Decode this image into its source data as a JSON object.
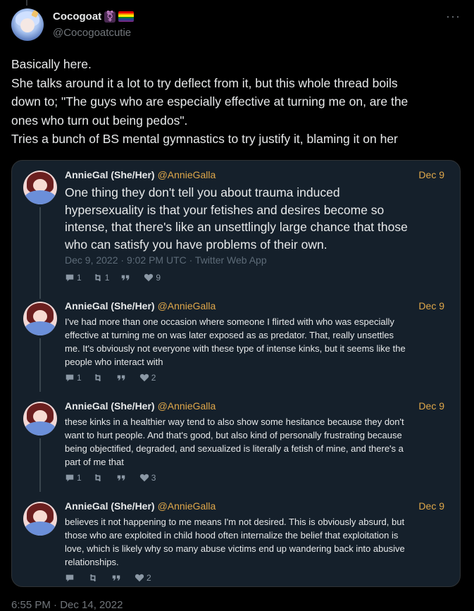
{
  "tweet": {
    "display_name": "Cocogoat",
    "handle": "@Cocogoatcutie",
    "body_lines": [
      "Basically here.",
      "She talks around it a lot to try deflect from it, but this whole thread boils",
      "down to; \"The guys who are especially effective at turning me on, are the",
      "ones who turn out being pedos\".",
      "Tries a bunch of BS mental gymnastics to try justify it, blaming it on her"
    ],
    "timestamp": "6:55 PM · Dec 14, 2022"
  },
  "quoted": [
    {
      "name": "AnnieGal (She/Her)",
      "handle": "@AnnieGalla",
      "date": "Dec 9",
      "lines": [
        "One thing they don't tell you about trauma induced",
        "hypersexuality is that your fetishes and desires become so",
        "intense, that there's like an unsettlingly large chance that those",
        "who can satisfy you have problems of their own."
      ],
      "meta": "Dec 9, 2022 · 9:02 PM UTC · Twitter Web App",
      "replies": "1",
      "retweets": "1",
      "quotes": "",
      "likes": "9"
    },
    {
      "name": "AnnieGal (She/Her)",
      "handle": "@AnnieGalla",
      "date": "Dec 9",
      "lines": [
        "I've had more than one occasion where someone I flirted with who was especially",
        "effective at turning me on was later exposed as as predator. That, really unsettles",
        "me. It's obviously not everyone with these type of intense kinks, but it seems like the",
        "people who interact with"
      ],
      "replies": "1",
      "retweets": "",
      "quotes": "",
      "likes": "2"
    },
    {
      "name": "AnnieGal (She/Her)",
      "handle": "@AnnieGalla",
      "date": "Dec 9",
      "lines": [
        "these kinks in a healthier way tend to also show some hesitance because they don't",
        "want to hurt people. And that's good, but also kind of personally frustrating because",
        "being objectified, degraded, and sexualized is literally a fetish of mine, and there's a",
        "part of me that"
      ],
      "replies": "1",
      "retweets": "",
      "quotes": "",
      "likes": "3"
    },
    {
      "name": "AnnieGal (She/Her)",
      "handle": "@AnnieGalla",
      "date": "Dec 9",
      "lines": [
        "believes it not happening to me means I'm not desired. This is obviously absurd, but",
        "those who are exploited in child hood often internalize the belief that exploitation is",
        "love, which is likely why so many abuse victims end up wandering back into abusive",
        "relationships."
      ],
      "replies": "",
      "retweets": "",
      "quotes": "",
      "likes": "2"
    }
  ],
  "icons": {
    "more": "more-horizontal-icon",
    "reply": "reply-icon",
    "retweet": "retweet-icon",
    "quote": "quote-icon",
    "like": "heart-icon",
    "gender_symbol": "transgender-symbol-icon",
    "flag": "rainbow-flag-icon"
  },
  "colors": {
    "background": "#000000",
    "quote_background": "#15202b",
    "accent_handle": "#e0a84a",
    "muted": "#71767b"
  }
}
